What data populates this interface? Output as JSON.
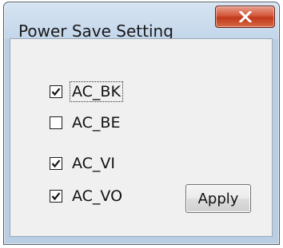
{
  "window": {
    "title": "Power Save Setting"
  },
  "checkboxes": [
    {
      "label": "AC_BK",
      "checked": true
    },
    {
      "label": "AC_BE",
      "checked": false
    },
    {
      "label": "AC_VI",
      "checked": true
    },
    {
      "label": "AC_VO",
      "checked": true
    }
  ],
  "buttons": {
    "apply_label": "Apply",
    "close_icon": "close-x"
  },
  "colors": {
    "close_button": "#c1391c",
    "titlebar": "#c3d6ea"
  }
}
